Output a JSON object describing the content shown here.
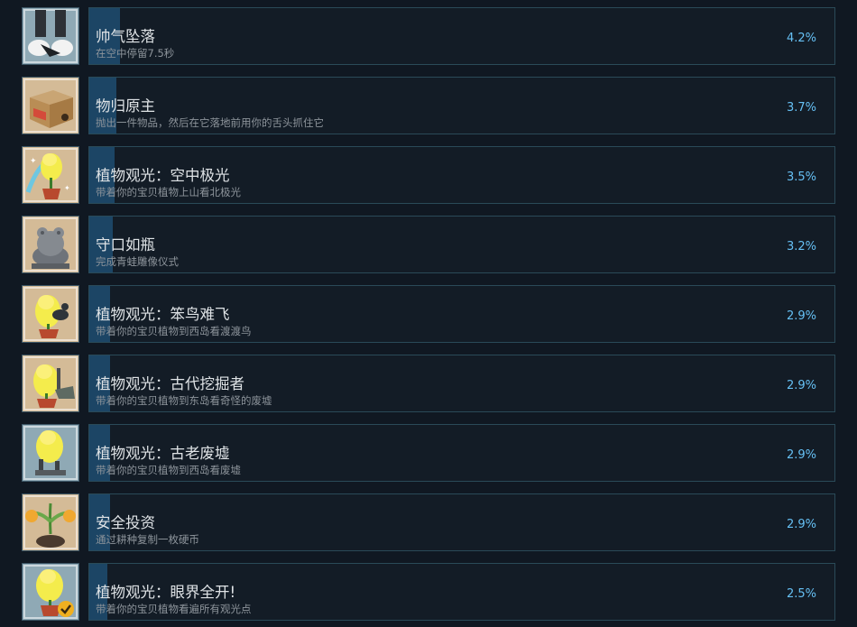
{
  "achievements": [
    {
      "title": "帅气坠落",
      "description": "在空中停留7.5秒",
      "percent_label": "4.2%",
      "percent": 4.2,
      "icon": "falling-legs-icon",
      "icon_bg": "#8fa9b5"
    },
    {
      "title": "物归原主",
      "description": "抛出一件物品，然后在它落地前用你的舌头抓住它",
      "percent_label": "3.7%",
      "percent": 3.7,
      "icon": "cardboard-box-icon",
      "icon_bg": "#d4bb97"
    },
    {
      "title": "植物观光：空中极光",
      "description": "带着你的宝贝植物上山看北极光",
      "percent_label": "3.5%",
      "percent": 3.5,
      "icon": "plant-aurora-icon",
      "icon_bg": "#d4bb97"
    },
    {
      "title": "守口如瓶",
      "description": "完成青蛙雕像仪式",
      "percent_label": "3.2%",
      "percent": 3.2,
      "icon": "frog-statue-icon",
      "icon_bg": "#d4bb97"
    },
    {
      "title": "植物观光：笨鸟难飞",
      "description": "带着你的宝贝植物到西岛看渡渡鸟",
      "percent_label": "2.9%",
      "percent": 2.9,
      "icon": "plant-dodo-icon",
      "icon_bg": "#d4bb97"
    },
    {
      "title": "植物观光：古代挖掘者",
      "description": "带着你的宝贝植物到东岛看奇怪的废墟",
      "percent_label": "2.9%",
      "percent": 2.9,
      "icon": "plant-ancient-digger-icon",
      "icon_bg": "#d4bb97"
    },
    {
      "title": "植物观光：古老废墟",
      "description": "带着你的宝贝植物到西岛看废墟",
      "percent_label": "2.9%",
      "percent": 2.9,
      "icon": "plant-ruins-icon",
      "icon_bg": "#8fa9b5"
    },
    {
      "title": "安全投资",
      "description": "通过耕种复制一枚硬币",
      "percent_label": "2.9%",
      "percent": 2.9,
      "icon": "coin-plant-icon",
      "icon_bg": "#d4bb97"
    },
    {
      "title": "植物观光：眼界全开!",
      "description": "带着你的宝贝植物看遍所有观光点",
      "percent_label": "2.5%",
      "percent": 2.5,
      "icon": "plant-checkmark-icon",
      "icon_bg": "#8fa9b5"
    }
  ]
}
